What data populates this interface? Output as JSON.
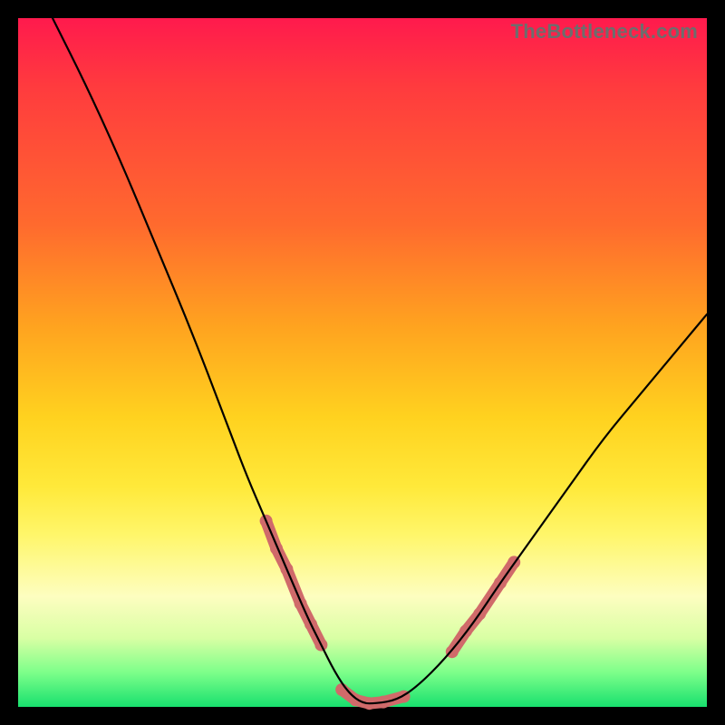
{
  "watermark": "TheBottleneck.com",
  "chart_data": {
    "type": "line",
    "title": "",
    "xlabel": "",
    "ylabel": "",
    "xlim": [
      0,
      100
    ],
    "ylim": [
      0,
      100
    ],
    "grid": false,
    "series": [
      {
        "name": "bottleneck-curve",
        "color": "#000000",
        "x": [
          5,
          10,
          15,
          20,
          25,
          30,
          33,
          36,
          39,
          42,
          44,
          46,
          48,
          50,
          52,
          55,
          58,
          62,
          66,
          70,
          75,
          80,
          85,
          90,
          95,
          100
        ],
        "y": [
          100,
          90,
          79,
          67,
          55,
          42,
          34,
          27,
          20,
          13,
          9,
          5,
          2,
          0.5,
          0.5,
          1,
          3,
          7,
          12,
          18,
          25,
          32,
          39,
          45,
          51,
          57
        ]
      }
    ],
    "markers": [
      {
        "name": "highlight-left-arm",
        "shape": "rounded-segment",
        "color": "#d06a6a",
        "points": [
          {
            "x": 36,
            "y": 27
          },
          {
            "x": 37.5,
            "y": 23
          },
          {
            "x": 39,
            "y": 20
          },
          {
            "x": 41,
            "y": 15
          },
          {
            "x": 42.5,
            "y": 12
          },
          {
            "x": 44,
            "y": 9
          }
        ]
      },
      {
        "name": "highlight-valley",
        "shape": "rounded-segment",
        "color": "#d06a6a",
        "points": [
          {
            "x": 47,
            "y": 2.5
          },
          {
            "x": 49,
            "y": 1
          },
          {
            "x": 51,
            "y": 0.5
          },
          {
            "x": 53,
            "y": 0.7
          },
          {
            "x": 56,
            "y": 1.5
          }
        ]
      },
      {
        "name": "highlight-right-arm",
        "shape": "rounded-segment",
        "color": "#d06a6a",
        "points": [
          {
            "x": 63,
            "y": 8
          },
          {
            "x": 65,
            "y": 11
          },
          {
            "x": 67,
            "y": 13.5
          },
          {
            "x": 70,
            "y": 18
          },
          {
            "x": 72,
            "y": 21
          }
        ]
      }
    ]
  }
}
